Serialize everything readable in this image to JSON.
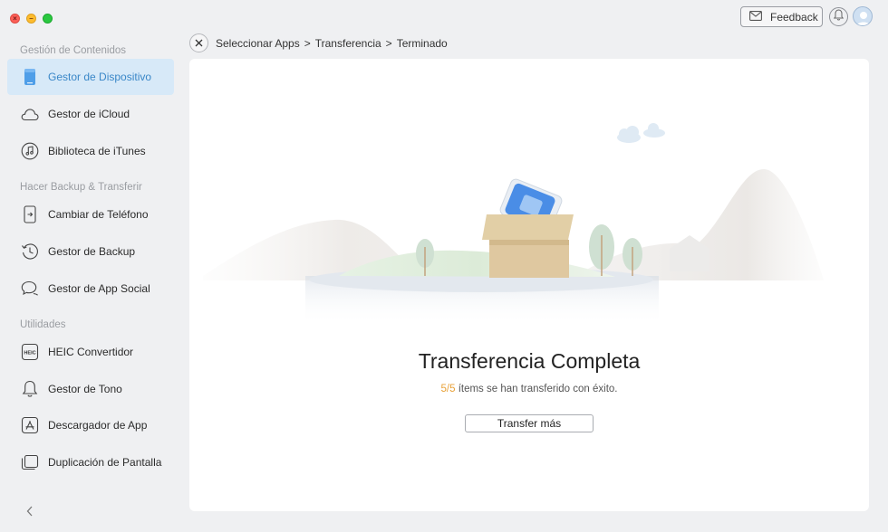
{
  "window": {
    "controls": [
      "close",
      "minimize",
      "maximize"
    ]
  },
  "topbar": {
    "feedback_label": "Feedback",
    "icons": [
      "mail-icon",
      "bell-icon",
      "avatar-icon"
    ]
  },
  "sidebar": {
    "sections": [
      {
        "title": "Gestión de Contenidos",
        "items": [
          {
            "label": "Gestor de Dispositivo",
            "icon": "phone-icon",
            "active": true
          },
          {
            "label": "Gestor de iCloud",
            "icon": "cloud-icon",
            "active": false
          },
          {
            "label": "Biblioteca de iTunes",
            "icon": "music-note-icon",
            "active": false
          }
        ]
      },
      {
        "title": "Hacer Backup & Transferir",
        "items": [
          {
            "label": "Cambiar de Teléfono",
            "icon": "phone-switch-icon",
            "active": false
          },
          {
            "label": "Gestor de Backup",
            "icon": "clock-history-icon",
            "active": false
          },
          {
            "label": "Gestor de App Social",
            "icon": "chat-bubbles-icon",
            "active": false
          }
        ]
      },
      {
        "title": "Utilidades",
        "items": [
          {
            "label": "HEIC Convertidor",
            "icon": "heic-icon",
            "active": false
          },
          {
            "label": "Gestor de Tono",
            "icon": "bell-outline-icon",
            "active": false
          },
          {
            "label": "Descargador de App",
            "icon": "app-store-icon",
            "active": false
          },
          {
            "label": "Duplicación de Pantalla",
            "icon": "screen-mirror-icon",
            "active": false
          }
        ]
      }
    ],
    "heic_icon_text": "HEIC",
    "collapse_icon": "chevron-left-icon"
  },
  "breadcrumb": {
    "steps": [
      "Seleccionar Apps",
      "Transferencia",
      "Terminado"
    ],
    "separator": ">"
  },
  "main": {
    "title": "Transferencia Completa",
    "count": "5/5",
    "message": " ítems se han transferido con éxito.",
    "button_label": "Transfer más"
  },
  "colors": {
    "accent": "#3a87c8",
    "active_bg": "#d7e9f8",
    "count_color": "#e8a23a",
    "background": "#eff0f2"
  }
}
